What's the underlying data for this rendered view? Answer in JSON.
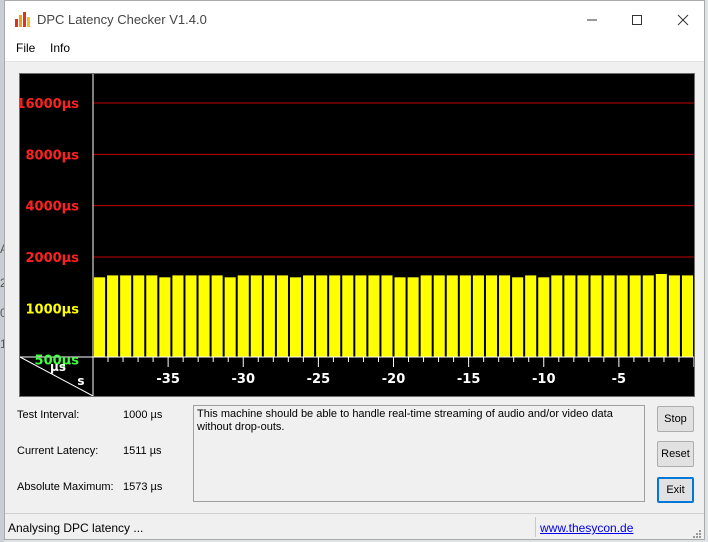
{
  "background": {
    "side_chars": [
      "A",
      "2",
      "0",
      "1"
    ]
  },
  "window": {
    "title": "DPC Latency Checker V1.4.0",
    "controls": [
      "minimize",
      "maximize",
      "close"
    ]
  },
  "menu": {
    "items": [
      {
        "label": "File"
      },
      {
        "label": "Info"
      }
    ]
  },
  "chart_data": {
    "type": "bar",
    "y_scale": "log2",
    "ytick_labels": [
      {
        "label": "16000µs",
        "value": 16000,
        "color": "#ff2020"
      },
      {
        "label": "8000µs",
        "value": 8000,
        "color": "#ff2020"
      },
      {
        "label": "4000µs",
        "value": 4000,
        "color": "#ff2020"
      },
      {
        "label": "2000µs",
        "value": 2000,
        "color": "#ff2020"
      },
      {
        "label": "1000µs",
        "value": 1000,
        "color": "#ffff00"
      },
      {
        "label": "500µs",
        "value": 500,
        "color": "#40ff40"
      }
    ],
    "gridlines_red": [
      16000,
      8000,
      4000,
      2000
    ],
    "corner_label_y": "µs",
    "corner_label_x": "s",
    "xtick_labels": [
      "-35",
      "-30",
      "-25",
      "-20",
      "-15",
      "-10",
      "-5"
    ],
    "xlim": [
      -40,
      0
    ],
    "bar_color": "#ffff00",
    "background": "#000000",
    "values": [
      1520,
      1560,
      1560,
      1560,
      1560,
      1520,
      1560,
      1560,
      1560,
      1560,
      1520,
      1560,
      1560,
      1560,
      1560,
      1520,
      1560,
      1560,
      1560,
      1560,
      1560,
      1560,
      1560,
      1520,
      1520,
      1560,
      1560,
      1560,
      1560,
      1560,
      1560,
      1560,
      1520,
      1560,
      1520,
      1560,
      1560,
      1560,
      1560,
      1560,
      1560,
      1560,
      1560,
      1590,
      1560,
      1560
    ]
  },
  "info": {
    "test_interval_label": "Test Interval:",
    "test_interval_value": "1000 µs",
    "current_latency_label": "Current Latency:",
    "current_latency_value": "1511 µs",
    "absolute_max_label": "Absolute Maximum:",
    "absolute_max_value": "1573 µs"
  },
  "message": "This machine should be able to handle real-time streaming of audio and/or video data without drop-outs.",
  "buttons": {
    "stop": "Stop",
    "reset": "Reset",
    "exit": "Exit"
  },
  "status": {
    "text": "Analysing DPC latency ...",
    "link": "www.thesycon.de"
  },
  "colors": {
    "grid_red": "#c00000",
    "bar": "#ffff00",
    "link": "#0000ee"
  }
}
